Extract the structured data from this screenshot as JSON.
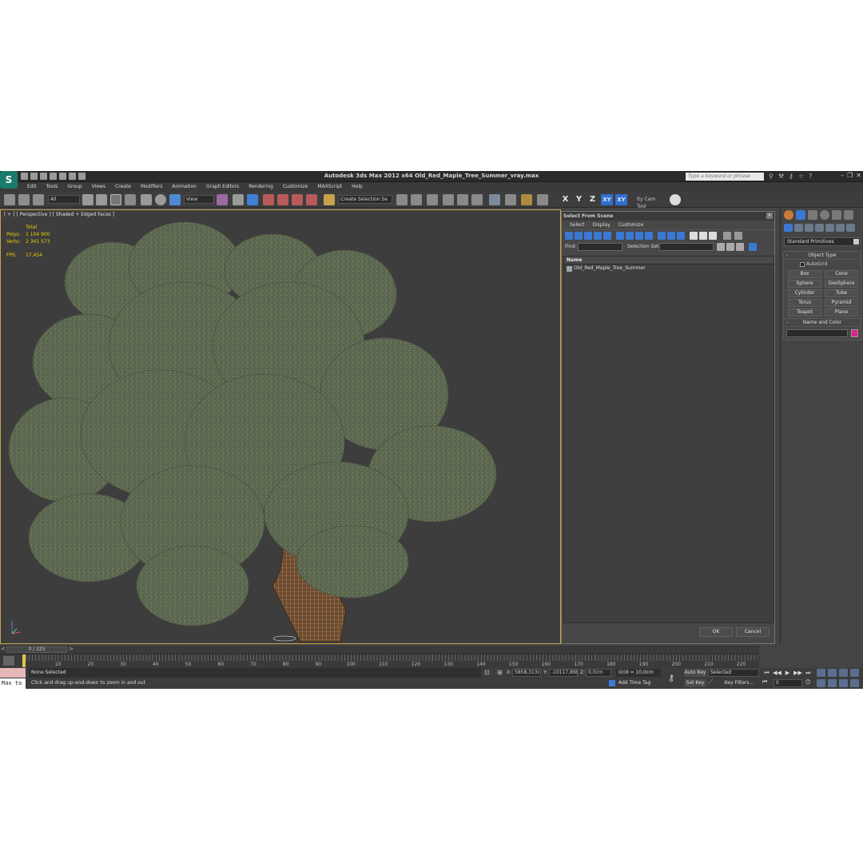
{
  "app": {
    "title": "Autodesk 3ds Max  2012 x64     Old_Red_Maple_Tree_Summer_vray.max",
    "logo": "3ds-max-logo",
    "search_placeholder": "Type a keyword or phrase"
  },
  "menu": [
    "Edit",
    "Tools",
    "Group",
    "Views",
    "Create",
    "Modifiers",
    "Animation",
    "Graph Editors",
    "Rendering",
    "Customize",
    "MAXScript",
    "Help"
  ],
  "toolbar": {
    "filter_value": "All",
    "refcoord_value": "View",
    "selection_set_value": "Create Selection Se",
    "axes": [
      "X",
      "Y",
      "Z",
      "XY",
      "XY"
    ],
    "cam_tool": "ity Cam Tool"
  },
  "viewport": {
    "label": "[ + ] [ Perspective ] [ Shaded + Edged Faces ]",
    "stats": {
      "total_label": "Total",
      "polys_label": "Polys:",
      "polys_value": "1 104 900",
      "verts_label": "Verts:",
      "verts_value": "2 341 573",
      "fps_label": "FPS:",
      "fps_value": "17,454"
    }
  },
  "select_from_scene": {
    "title": "Select From Scene",
    "menu": [
      "Select",
      "Display",
      "Customize"
    ],
    "find_label": "Find:",
    "selection_set_label": "Selection Set:",
    "column_name": "Name",
    "items": [
      "Old_Red_Maple_Tree_Summer"
    ],
    "ok_label": "OK",
    "cancel_label": "Cancel"
  },
  "command_panel": {
    "category": "Standard Primitives",
    "object_type_title": "Object Type",
    "autogrid_label": "AutoGrid",
    "primitives": [
      "Box",
      "Cone",
      "Sphere",
      "GeoSphere",
      "Cylinder",
      "Tube",
      "Torus",
      "Pyramid",
      "Teapot",
      "Plane"
    ],
    "name_color_title": "Name and Color",
    "swatch_color": "#e2228a"
  },
  "timeline": {
    "slider_label": "0 / 225",
    "ticks": [
      "0",
      "10",
      "20",
      "30",
      "40",
      "50",
      "60",
      "70",
      "80",
      "90",
      "100",
      "110",
      "120",
      "130",
      "140",
      "150",
      "160",
      "170",
      "180",
      "190",
      "200",
      "210",
      "220"
    ]
  },
  "status": {
    "maxscript_text": "Max to",
    "selection_text": "None Selected",
    "prompt_text": "Click and drag up-and-down to zoom in and out",
    "x_label": "X:",
    "x_value": "5858,313c",
    "y_label": "Y:",
    "y_value": "-10117,89(",
    "z_label": "Z:",
    "z_value": "0,0cm",
    "grid_text": "Grid = 10,0cm",
    "add_time_tag": "Add Time Tag",
    "auto_key": "Auto Key",
    "set_key": "Set Key",
    "selected_value": "Selected",
    "key_filters": "Key Filters...",
    "frame_value": "0"
  }
}
